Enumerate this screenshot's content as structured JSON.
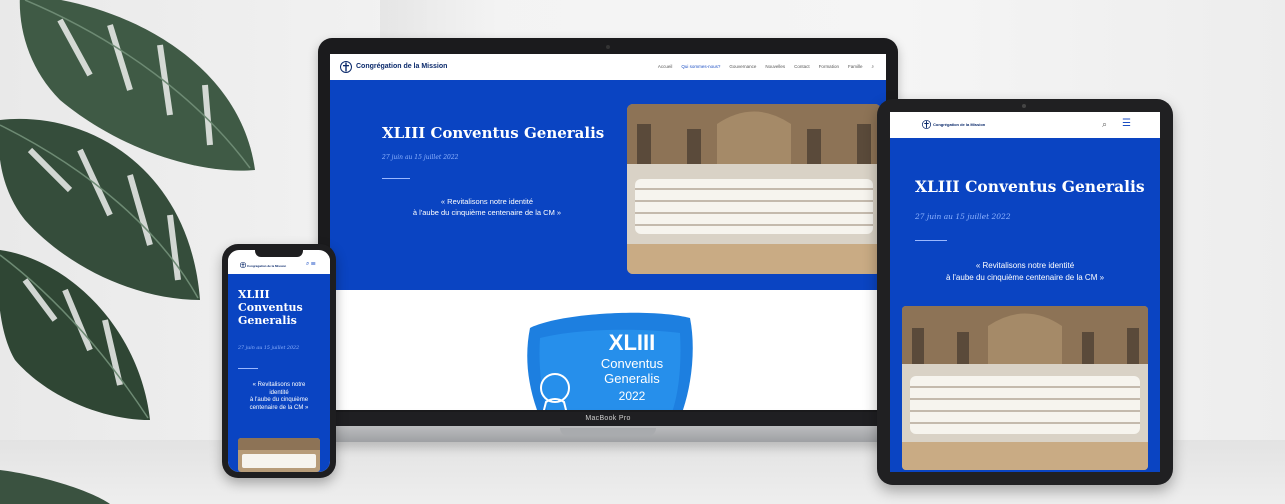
{
  "site": {
    "logo_name": "Congrégation de la Mission",
    "logo_name_short": "Congrégation de la Mission"
  },
  "laptop": {
    "nav_items": [
      "Accueil",
      "Qui sommes-nous?",
      "Gouvernance",
      "Nouvelles",
      "Contact",
      "Formation",
      "Famille"
    ],
    "active_index": 1,
    "device_label": "MacBook Pro"
  },
  "hero": {
    "title": "XLIII Conventus Generalis",
    "title_phone_line1": "XLIII",
    "title_phone_line2": "Conventus",
    "title_phone_line3": "Generalis",
    "date": "27 juin au 15 juillet 2022",
    "quote_line1": "« Revitalisons notre identité",
    "quote_line2": "à l'aube du cinquième centenaire de la CM »",
    "quote_phone_line1": "« Revitalisons notre",
    "quote_phone_line2": "identité",
    "quote_phone_line3": "à l'aube du cinquième",
    "quote_phone_line4": "centenaire de la CM »"
  },
  "event_logo": {
    "line1": "XLIII",
    "line2": "Conventus",
    "line3": "Generalis",
    "line4": "2022"
  },
  "colors": {
    "hero_blue": "#0a44c2",
    "date_blue": "#8fb4ff",
    "logo_navy": "#0b2a6b"
  }
}
